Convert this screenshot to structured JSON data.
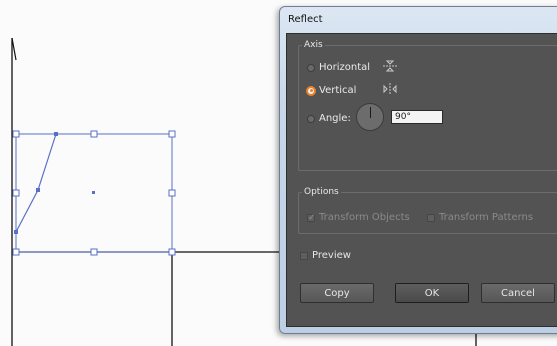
{
  "dialog": {
    "title": "Reflect",
    "axis": {
      "label": "Axis",
      "horizontal_label": "Horizontal",
      "vertical_label": "Vertical",
      "angle_label": "Angle:",
      "angle_value": "90°",
      "selected": "Vertical"
    },
    "options": {
      "label": "Options",
      "transform_objects_label": "Transform Objects",
      "transform_objects_checked": true,
      "transform_patterns_label": "Transform Patterns",
      "transform_patterns_checked": false
    },
    "preview_label": "Preview",
    "preview_checked": false,
    "buttons": {
      "copy": "Copy",
      "ok": "OK",
      "cancel": "Cancel"
    }
  },
  "colors": {
    "selection_blue": "#5a6fc8",
    "radio_accent": "#e8832a",
    "dialog_bg": "#535353"
  }
}
